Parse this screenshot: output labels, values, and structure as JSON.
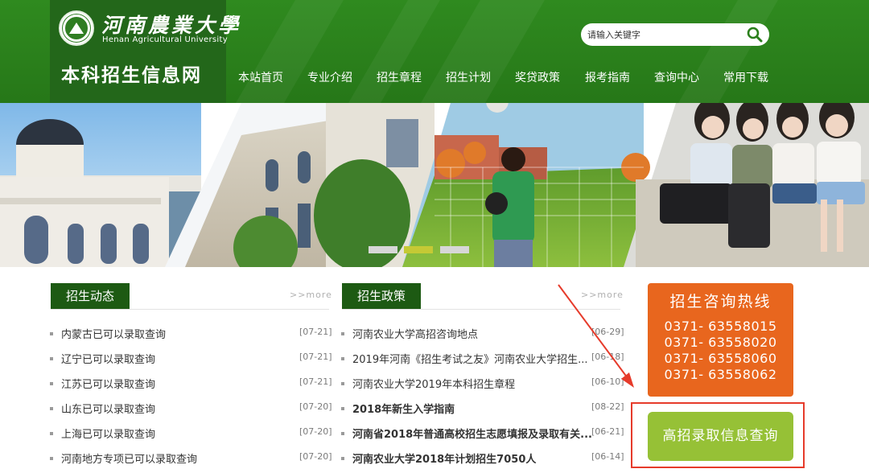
{
  "header": {
    "university_cn": "河南農業大學",
    "university_en": "Henan Agricultural University",
    "site_title": "本科招生信息网",
    "search": {
      "placeholder": "请输入关键字"
    },
    "nav": [
      "本站首页",
      "专业介绍",
      "招生章程",
      "招生计划",
      "奖贷政策",
      "报考指南",
      "查询中心",
      "常用下载"
    ]
  },
  "banner": {
    "slides": 3,
    "active_slide": 2
  },
  "columns": {
    "left": {
      "title": "招生动态",
      "more": ">>more",
      "items": [
        {
          "text": "内蒙古已可以录取查询",
          "date": "[07-21]"
        },
        {
          "text": "辽宁已可以录取查询",
          "date": "[07-21]"
        },
        {
          "text": "江苏已可以录取查询",
          "date": "[07-21]"
        },
        {
          "text": "山东已可以录取查询",
          "date": "[07-20]"
        },
        {
          "text": "上海已可以录取查询",
          "date": "[07-20]"
        },
        {
          "text": "河南地方专项已可以录取查询",
          "date": "[07-20]"
        }
      ]
    },
    "middle": {
      "title": "招生政策",
      "more": ">>more",
      "items": [
        {
          "text": "河南农业大学高招咨询地点",
          "date": "[06-29]"
        },
        {
          "text": "2019年河南《招生考试之友》河南农业大学招生...",
          "date": "[06-18]"
        },
        {
          "text": "河南农业大学2019年本科招生章程",
          "date": "[06-10]"
        },
        {
          "text": "2018年新生入学指南",
          "date": "[08-22]"
        },
        {
          "text": "河南省2018年普通高校招生志愿填报及录取有关...",
          "date": "[06-21]"
        },
        {
          "text": "河南农业大学2018年计划招生7050人",
          "date": "[06-14]"
        }
      ]
    }
  },
  "hotline": {
    "title": "招生咨询热线",
    "phones": [
      "0371- 63558015",
      "0371- 63558020",
      "0371- 63558060",
      "0371- 63558062"
    ]
  },
  "query_button": {
    "label": "高招录取信息查询"
  },
  "colors": {
    "header_green": "#2a7f1b",
    "dark_green": "#1d5a13",
    "hotline_orange": "#e8661e",
    "query_green": "#96c136",
    "highlight_red": "#e63b2b"
  }
}
